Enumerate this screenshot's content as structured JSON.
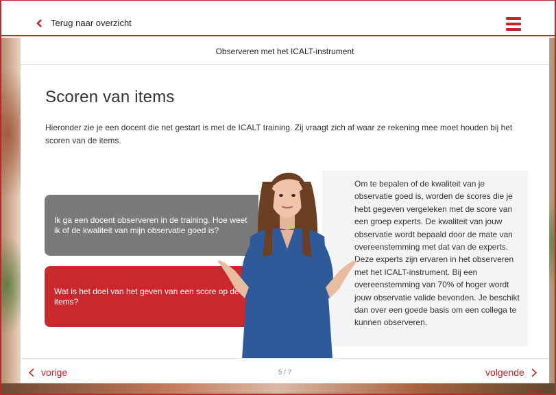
{
  "header": {
    "back_label": "Terug naar overzicht"
  },
  "card": {
    "module_title": "Observeren met het ICALT-instrument",
    "heading": "Scoren van items",
    "intro": "Hieronder zie je een docent die net gestart is met de ICALT training. Zij vraagt zich af waar ze rekening mee moet houden bij het scoren van de items."
  },
  "questions": [
    {
      "label": "Ik ga een docent observeren in de training. Hoe weet ik of de kwaliteit van mijn observatie goed is?"
    },
    {
      "label": "Wat is het doel van het geven van een score op de items?"
    }
  ],
  "answer": {
    "text": "Om te bepalen of de kwaliteit van je observatie goed is, worden de scores die je hebt gegeven vergeleken met de score van een groep experts. De kwaliteit van jouw observatie wordt bepaald door de mate van overeenstemming met dat van de experts. Deze experts zijn ervaren in het observeren met het ICALT-instrument. Bij een overeenstemming van 70% of hoger wordt jouw observatie valide bevonden. Je beschikt dan over een goede basis om een collega te kunnen observeren."
  },
  "footer": {
    "prev_label": "vorige",
    "next_label": "volgende",
    "page_indicator": "5 / 7"
  },
  "colors": {
    "accent": "#c0262c",
    "question_gray": "#7a7a7a",
    "question_red": "#c9282c"
  },
  "icons": {
    "back": "chevron-left-icon",
    "menu": "hamburger-menu-icon",
    "prev": "chevron-left-icon",
    "next": "chevron-right-icon"
  }
}
